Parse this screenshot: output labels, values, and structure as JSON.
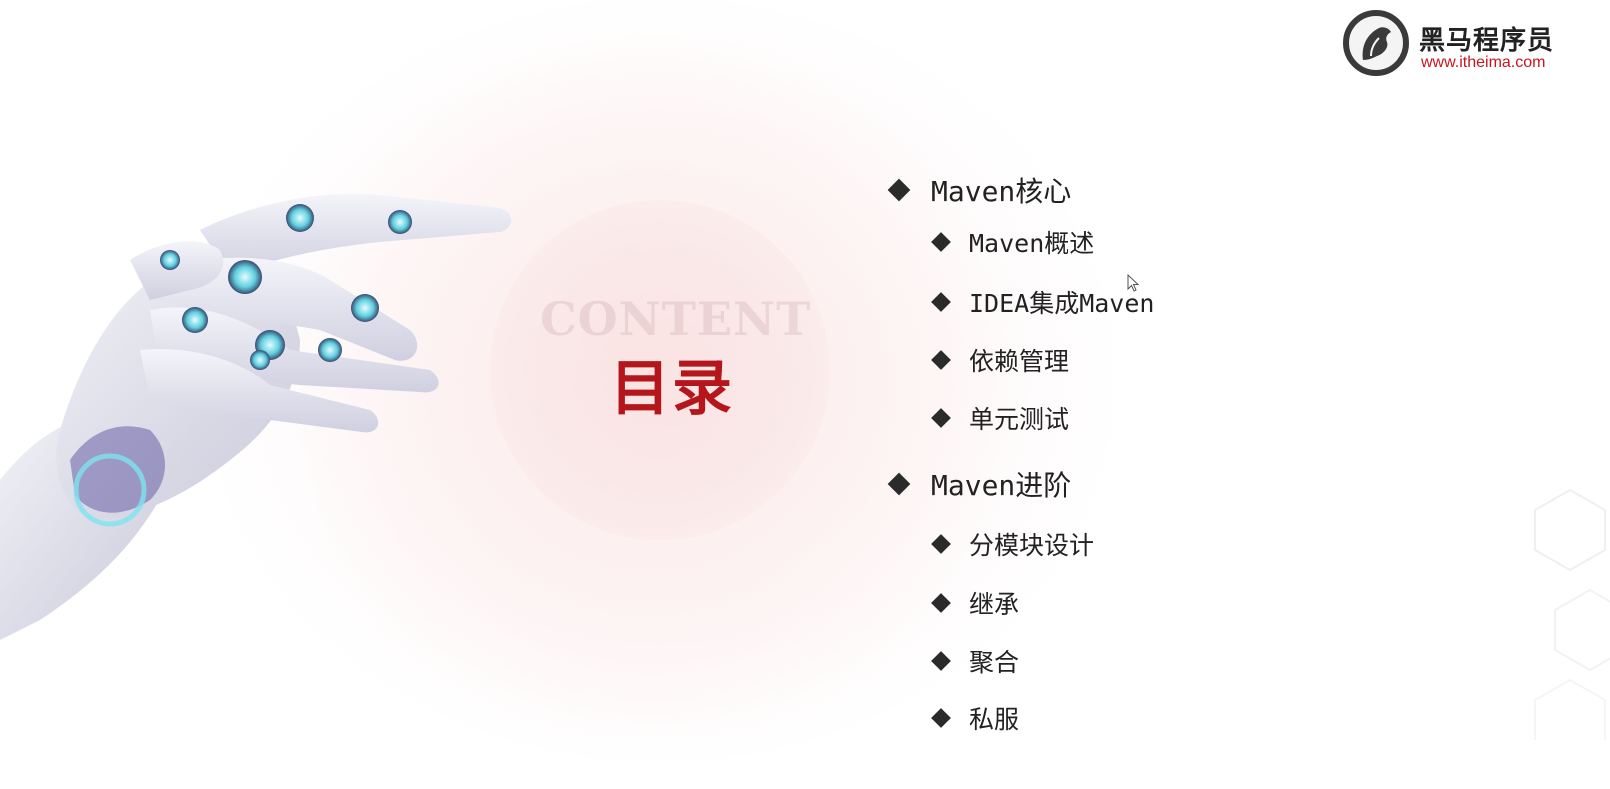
{
  "slide": {
    "watermark": "CONTENT",
    "title": "目录"
  },
  "logo": {
    "name": "黑马程序员",
    "url": "www.itheima.com",
    "icon": "horse-head-logo-icon",
    "brand_color": "#c8161d"
  },
  "toc": {
    "items": [
      {
        "level": 1,
        "label": "Maven核心"
      },
      {
        "level": 2,
        "label": "Maven概述"
      },
      {
        "level": 2,
        "label": "IDEA集成Maven"
      },
      {
        "level": 2,
        "label": "依赖管理"
      },
      {
        "level": 2,
        "label": "单元测试"
      },
      {
        "level": 1,
        "label": "Maven进阶"
      },
      {
        "level": 2,
        "label": "分模块设计"
      },
      {
        "level": 2,
        "label": "继承"
      },
      {
        "level": 2,
        "label": "聚合"
      },
      {
        "level": 2,
        "label": "私服"
      }
    ]
  },
  "colors": {
    "title": "#b5161b",
    "text": "#222222",
    "bullet": "#2b2b2b"
  },
  "decorations": {
    "hand": "robot-hand-image",
    "cursor": "mouse-pointer-icon"
  }
}
